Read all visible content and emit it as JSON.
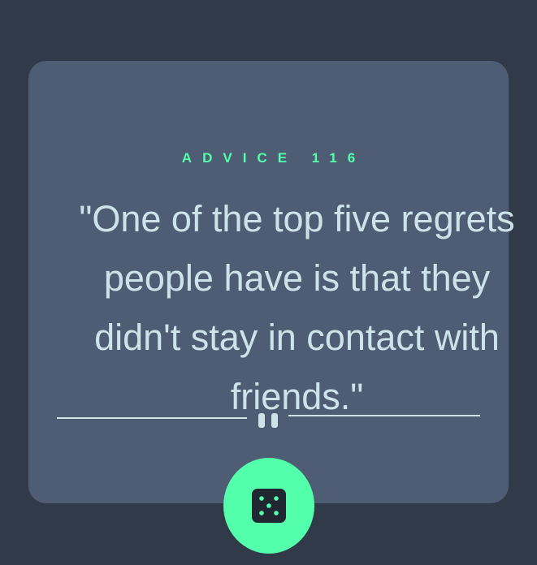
{
  "advice": {
    "label": "ADVICE 116",
    "quote": "\"One of the top five regrets people have is that they didn't stay in contact with friends.\""
  },
  "divider": {
    "icon": "pause-icon"
  },
  "dice_button": {
    "icon": "dice-icon"
  },
  "colors": {
    "background": "#313a48",
    "card": "#4e5d73",
    "accent": "#53ffaa",
    "text": "#cee3e9",
    "dice_face": "#202733"
  }
}
